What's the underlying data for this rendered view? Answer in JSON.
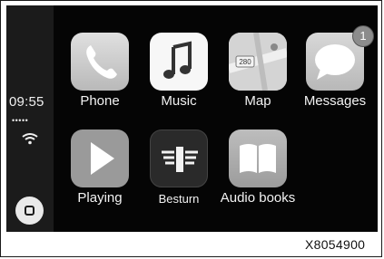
{
  "status": {
    "time": "09:55",
    "signal": "•••••"
  },
  "apps": [
    {
      "label": "Phone",
      "icon": "phone-icon"
    },
    {
      "label": "Music",
      "icon": "music-note-icon"
    },
    {
      "label": "Map",
      "icon": "map-icon",
      "map_sign": "280"
    },
    {
      "label": "Messages",
      "icon": "messages-icon",
      "badge": "1"
    },
    {
      "label": "Playing",
      "icon": "play-icon"
    },
    {
      "label": "Besturn",
      "icon": "besturn-logo-icon"
    },
    {
      "label": "Audio books",
      "icon": "book-icon"
    }
  ],
  "caption": "X8054900",
  "colors": {
    "screen": "#050505",
    "sidebar": "#1b1b1b",
    "tile": "#cfcfcf"
  }
}
